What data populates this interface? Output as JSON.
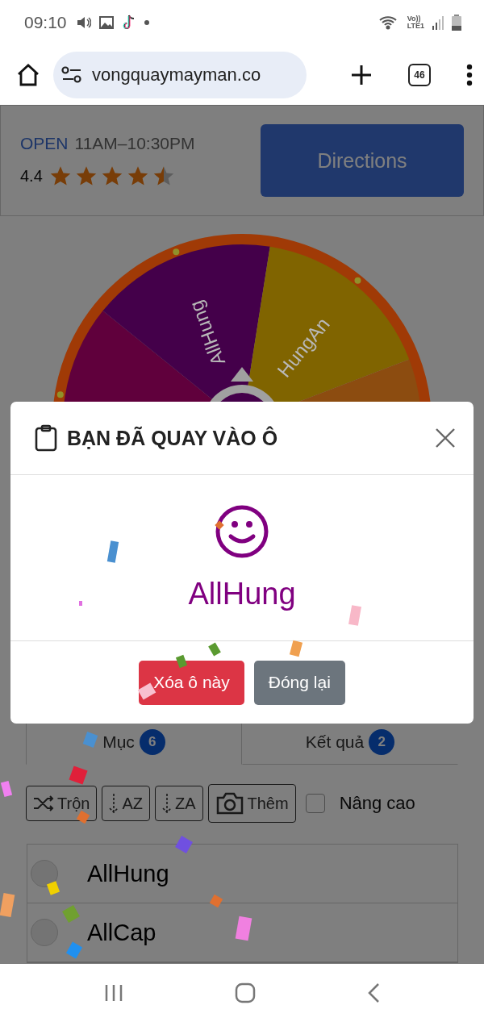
{
  "status_bar": {
    "time": "09:10",
    "network_top": "Vo))",
    "network_bottom": "LTE1"
  },
  "browser": {
    "url": "vongquaymayman.co",
    "tab_count": "46"
  },
  "ad": {
    "status": "OPEN",
    "hours": "11AM–10:30PM",
    "rating": "4.4",
    "stars": 4.5,
    "button": "Directions"
  },
  "wheel": {
    "segments": [
      {
        "color": "#60003c"
      },
      {
        "label": "AllHung",
        "color": "#44004a"
      },
      {
        "label": "HungAn",
        "color": "#806400"
      },
      {
        "color": "#8c4c10"
      }
    ]
  },
  "tabs": [
    {
      "label": "Mục",
      "count": "6",
      "selected": true
    },
    {
      "label": "Kết quả",
      "count": "2",
      "selected": false
    }
  ],
  "toolbar": {
    "buttons": [
      {
        "kind": "shuffle",
        "label": "Trộn"
      },
      {
        "kind": "sort",
        "label": "AZ"
      },
      {
        "kind": "sort",
        "label": "ZA"
      },
      {
        "kind": "camera",
        "label": "Thêm"
      }
    ],
    "advanced": {
      "label": "Nâng cao",
      "checked": false
    }
  },
  "items": [
    {
      "name": "AllHung",
      "selected": false
    },
    {
      "name": "AllCap",
      "selected": false
    }
  ],
  "modal": {
    "title": "BẠN ĐÃ QUAY VÀO Ô",
    "result": "AllHung",
    "buttons": [
      {
        "kind": "danger",
        "label": "Xóa ô này"
      },
      {
        "kind": "secondary",
        "label": "Đóng lại"
      }
    ]
  }
}
